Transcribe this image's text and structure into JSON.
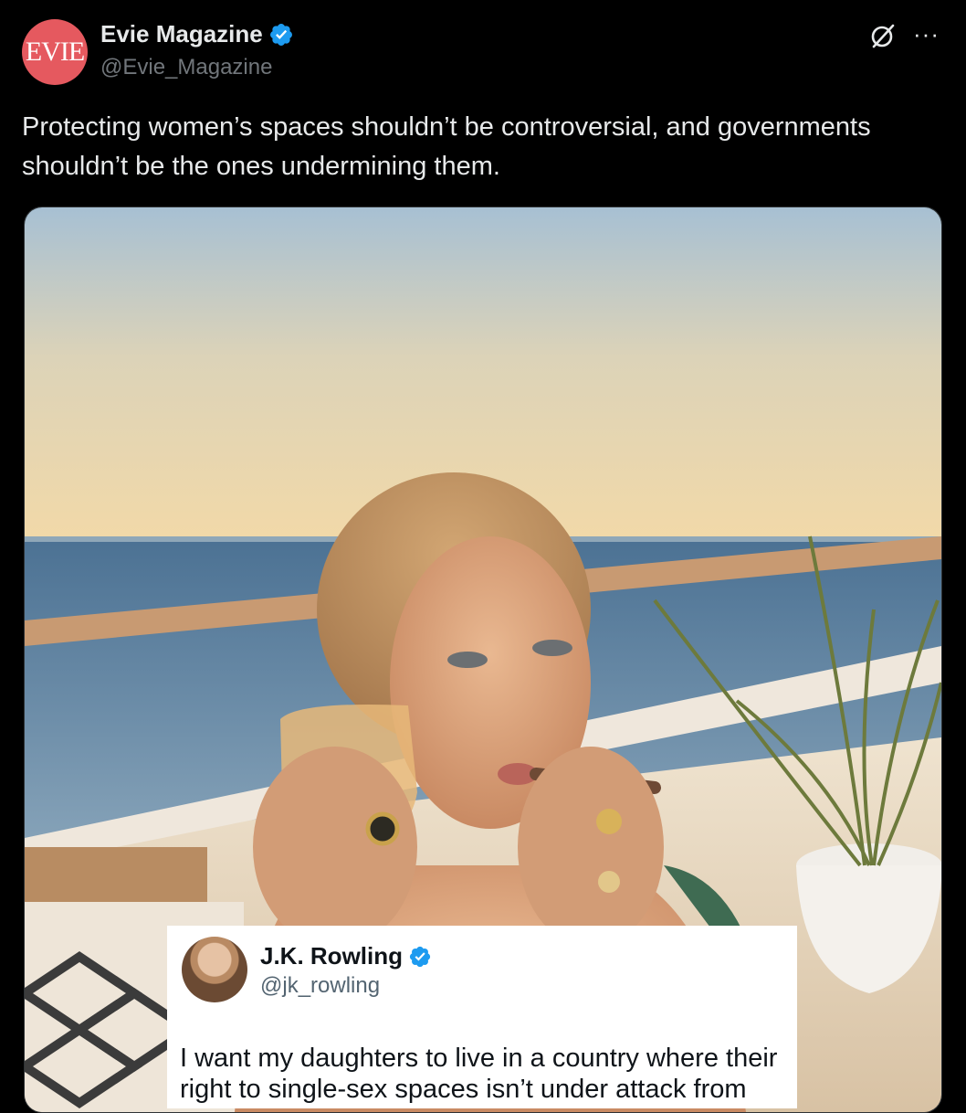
{
  "post": {
    "avatar_text": "EVIE",
    "display_name": "Evie Magazine",
    "handle": "@Evie_Magazine",
    "text": "Protecting women’s spaces shouldn’t be controversial, and governments shouldn’t be the ones undermining them."
  },
  "quoted": {
    "display_name": "J.K. Rowling",
    "handle": "@jk_rowling",
    "text": "I want my daughters to live in a country where their right to single-sex spaces isn’t under attack from"
  },
  "colors": {
    "background": "#000000",
    "verified": "#1d9bf0",
    "evie_brand": "#e5595f"
  },
  "icons": [
    "verified-badge-icon",
    "grok-icon",
    "more-icon"
  ]
}
